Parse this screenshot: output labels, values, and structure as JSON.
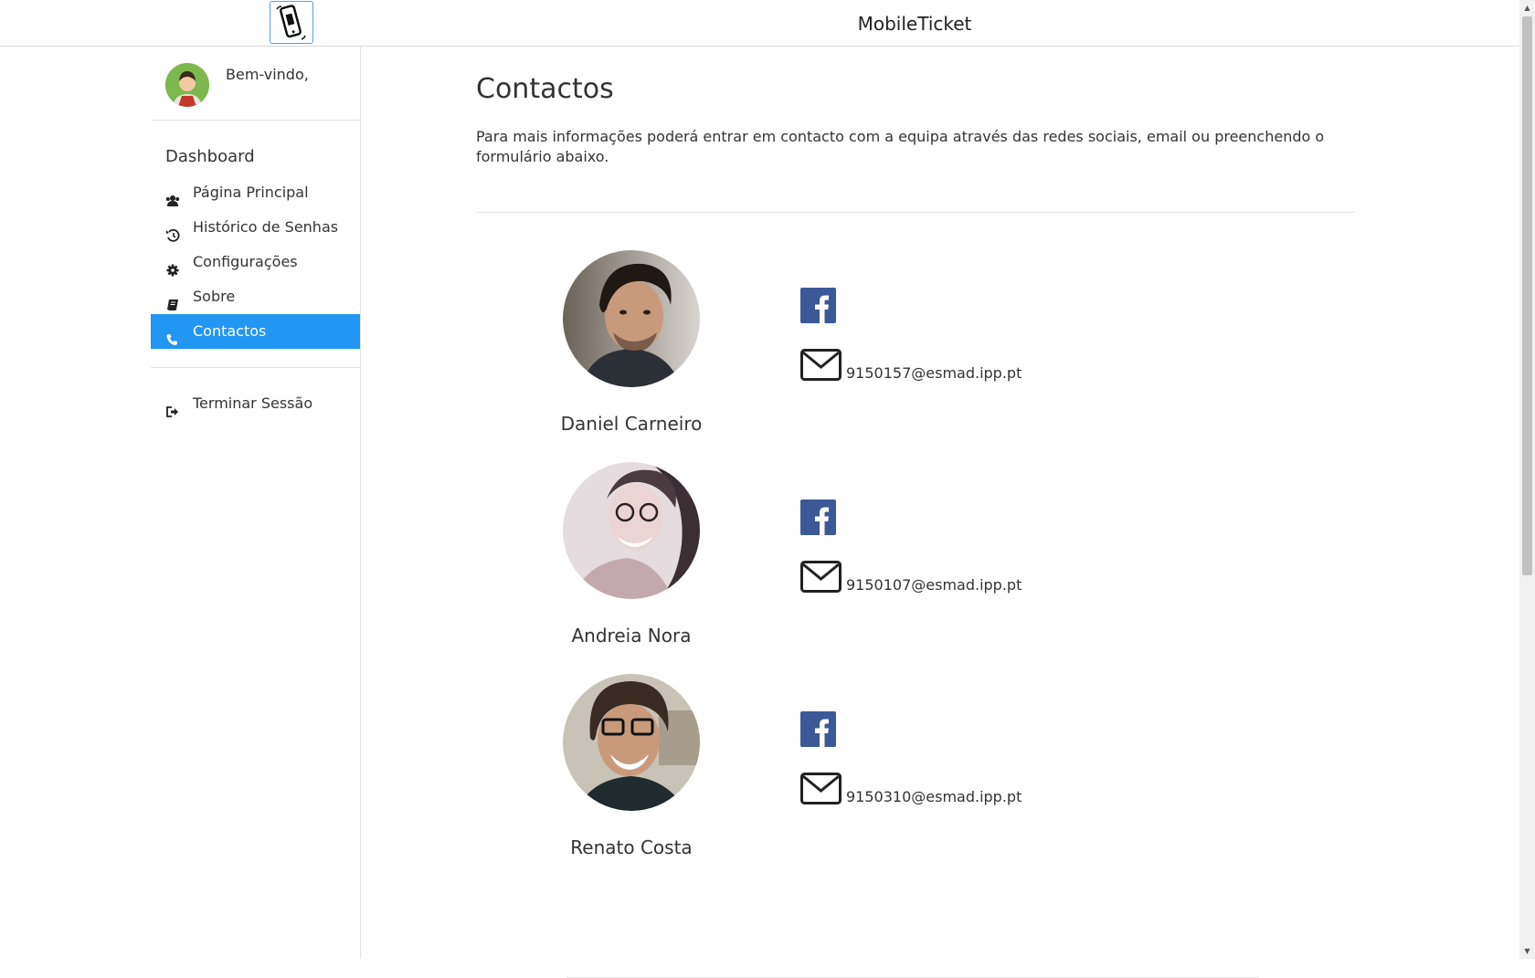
{
  "header": {
    "app_title": "MobileTicket",
    "logo_icon": "mobile-ticket-logo-icon"
  },
  "sidebar": {
    "welcome": "Bem-vindo,",
    "section_title": "Dashboard",
    "items": [
      {
        "label": "Página Principal",
        "icon": "users-icon",
        "active": false
      },
      {
        "label": "Histórico de Senhas",
        "icon": "history-icon",
        "active": false
      },
      {
        "label": "Configurações",
        "icon": "gear-icon",
        "active": false
      },
      {
        "label": "Sobre",
        "icon": "book-icon",
        "active": false
      },
      {
        "label": "Contactos",
        "icon": "phone-icon",
        "active": true
      }
    ],
    "logout": {
      "label": "Terminar Sessão",
      "icon": "sign-out-icon"
    }
  },
  "main": {
    "title": "Contactos",
    "intro": "Para mais informações poderá entrar em contacto com a equipa através das redes sociais, email ou preenchendo o formulário abaixo.",
    "contacts": [
      {
        "name": "Daniel Carneiro",
        "email": "9150157@esmad.ipp.pt"
      },
      {
        "name": "Andreia Nora",
        "email": "9150107@esmad.ipp.pt"
      },
      {
        "name": "Renato Costa",
        "email": "9150310@esmad.ipp.pt"
      }
    ]
  },
  "colors": {
    "accent": "#2196f3",
    "facebook": "#3b5998"
  }
}
